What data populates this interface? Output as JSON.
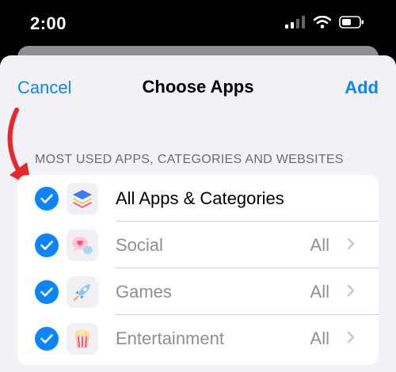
{
  "status_bar": {
    "time": "2:00",
    "icons": [
      "cellular-signal-icon",
      "wifi-icon",
      "battery-icon"
    ]
  },
  "nav": {
    "cancel_label": "Cancel",
    "title": "Choose Apps",
    "add_label": "Add"
  },
  "section_header": "MOST USED APPS, CATEGORIES AND WEBSITES",
  "rows": [
    {
      "label": "All Apps & Categories",
      "value": "",
      "checked": true,
      "icon": "stack-icon"
    },
    {
      "label": "Social",
      "value": "All",
      "checked": true,
      "icon": "speech-bubble-heart-icon"
    },
    {
      "label": "Games",
      "value": "All",
      "checked": true,
      "icon": "rocket-icon"
    },
    {
      "label": "Entertainment",
      "value": "All",
      "checked": true,
      "icon": "popcorn-icon"
    }
  ],
  "colors": {
    "accent": "#0a84ff",
    "annotation_arrow": "#e8262c",
    "sheet_bg": "#f2f2f7"
  }
}
